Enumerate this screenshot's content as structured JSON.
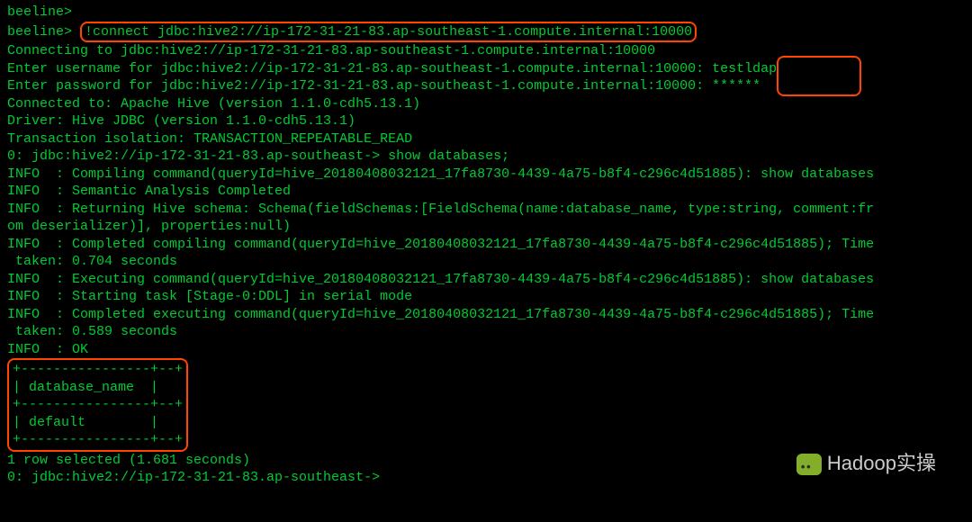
{
  "prompt1": "beeline>",
  "prompt2": "beeline> ",
  "connect_cmd": "!connect jdbc:hive2://ip-172-31-21-83.ap-southeast-1.compute.internal:10000",
  "connecting": "Connecting to jdbc:hive2://ip-172-31-21-83.ap-southeast-1.compute.internal:10000",
  "user_prompt": "Enter username for jdbc:hive2://ip-172-31-21-83.ap-southeast-1.compute.internal:10000: ",
  "username": "testldap",
  "pass_prompt": "Enter password for jdbc:hive2://ip-172-31-21-83.ap-southeast-1.compute.internal:10000: ",
  "password": "******",
  "connected": "Connected to: Apache Hive (version 1.1.0-cdh5.13.1)",
  "driver": "Driver: Hive JDBC (version 1.1.0-cdh5.13.1)",
  "isolation": "Transaction isolation: TRANSACTION_REPEATABLE_READ",
  "jdbc_prompt": "0: jdbc:hive2://ip-172-31-21-83.ap-southeast-> ",
  "show_db": "show databases;",
  "info1": "INFO  : Compiling command(queryId=hive_20180408032121_17fa8730-4439-4a75-b8f4-c296c4d51885): show databases",
  "info2": "INFO  : Semantic Analysis Completed",
  "info3a": "INFO  : Returning Hive schema: Schema(fieldSchemas:[FieldSchema(name:database_name, type:string, comment:fr",
  "info3b": "om deserializer)], properties:null)",
  "info4a": "INFO  : Completed compiling command(queryId=hive_20180408032121_17fa8730-4439-4a75-b8f4-c296c4d51885); Time",
  "info4b": " taken: 0.704 seconds",
  "info5": "INFO  : Executing command(queryId=hive_20180408032121_17fa8730-4439-4a75-b8f4-c296c4d51885): show databases",
  "info6": "INFO  : Starting task [Stage-0:DDL] in serial mode",
  "info7a": "INFO  : Completed executing command(queryId=hive_20180408032121_17fa8730-4439-4a75-b8f4-c296c4d51885); Time",
  "info7b": " taken: 0.589 seconds",
  "info8": "INFO  : OK",
  "table_border": "+----------------+--+",
  "table_header": "| database_name  |",
  "table_row": "| default        |",
  "rows_selected": "1 row selected (1.681 seconds)",
  "final_prompt": "0: jdbc:hive2://ip-172-31-21-83.ap-southeast->",
  "watermark": "Hadoop实操"
}
